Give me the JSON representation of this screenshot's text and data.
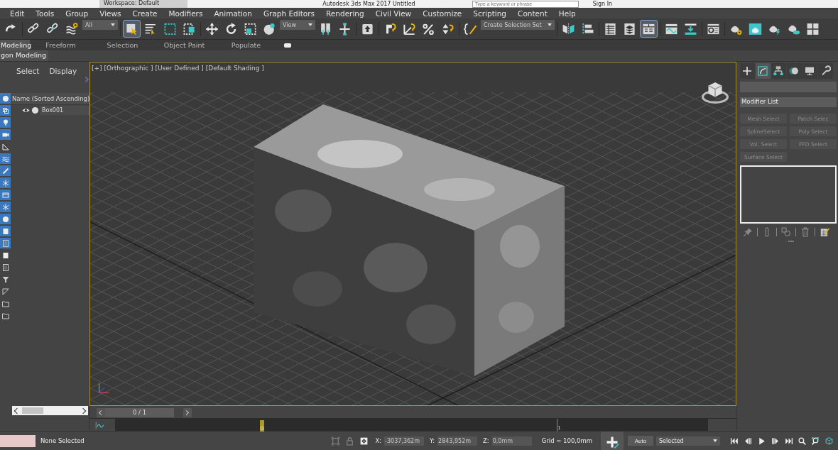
{
  "title_bar": {
    "workspace": "Workspace: Default",
    "title": "Autodesk 3ds Max 2017   Untitled",
    "search": {
      "placeholder": "Type a keyword or phrase"
    },
    "sign_in": "Sign In"
  },
  "menu": [
    "Edit",
    "Tools",
    "Group",
    "Views",
    "Create",
    "Modifiers",
    "Animation",
    "Graph Editors",
    "Rendering",
    "Civil View",
    "Customize",
    "Scripting",
    "Content",
    "Help"
  ],
  "toolbar": [
    {
      "kind": "tool",
      "selected": false
    },
    {
      "kind": "tool",
      "selected": false
    },
    {
      "kind": "tool",
      "selected": false
    },
    {
      "kind": "tool",
      "selected": false
    },
    {
      "kind": "dropdown",
      "value": "All"
    },
    {
      "kind": "tool",
      "selected": true
    },
    {
      "kind": "tool",
      "selected": false
    },
    {
      "kind": "tool",
      "selected": false
    },
    {
      "kind": "tool",
      "selected": false
    },
    {
      "kind": "tool",
      "selected": false
    },
    {
      "kind": "tool",
      "selected": false
    },
    {
      "kind": "tool",
      "selected": false
    },
    {
      "kind": "tool",
      "selected": false
    },
    {
      "kind": "dropdown",
      "value": "View"
    },
    {
      "kind": "tool",
      "selected": false
    },
    {
      "kind": "tool",
      "selected": false
    },
    {
      "kind": "tool",
      "selected": false
    },
    {
      "kind": "tool",
      "selected": false
    },
    {
      "kind": "tool",
      "selected": false
    },
    {
      "kind": "tool",
      "selected": false
    },
    {
      "kind": "tool",
      "selected": false
    },
    {
      "kind": "tool",
      "selected": false
    },
    {
      "kind": "dropdown",
      "value": "Create Selection Set"
    },
    {
      "kind": "tool",
      "selected": false
    },
    {
      "kind": "tool",
      "selected": false
    },
    {
      "kind": "tool",
      "selected": false
    },
    {
      "kind": "tool",
      "selected": false
    },
    {
      "kind": "tool",
      "selected": true
    },
    {
      "kind": "tool",
      "selected": false
    },
    {
      "kind": "tool",
      "selected": false
    },
    {
      "kind": "tool",
      "selected": false
    },
    {
      "kind": "tool",
      "selected": false
    },
    {
      "kind": "tool",
      "selected": false
    },
    {
      "kind": "tool",
      "selected": false
    },
    {
      "kind": "tool",
      "selected": false
    },
    {
      "kind": "tool",
      "selected": false
    }
  ],
  "ribbon": {
    "tabs": [
      {
        "label": "Modeling",
        "selected": true
      },
      {
        "label": "Freeform",
        "selected": false
      },
      {
        "label": "Selection",
        "selected": false
      },
      {
        "label": "Object Paint",
        "selected": false
      },
      {
        "label": "Populate",
        "selected": false
      }
    ],
    "panel_tab": "gon Modeling"
  },
  "scene_explorer": {
    "menu": [
      "Select",
      "Display"
    ],
    "filters": [
      {
        "selected": true
      },
      {
        "selected": true
      },
      {
        "selected": true
      },
      {
        "selected": true
      },
      {
        "selected": false
      },
      {
        "selected": true
      },
      {
        "selected": true
      },
      {
        "selected": true
      },
      {
        "selected": true
      },
      {
        "selected": true
      },
      {
        "selected": true
      },
      {
        "selected": true
      },
      {
        "selected": true
      },
      {
        "selected": false
      },
      {
        "selected": false
      },
      {
        "selected": false
      },
      {
        "selected": false
      },
      {
        "selected": false
      },
      {
        "selected": false
      }
    ],
    "column": "Name (Sorted Ascending)",
    "rows": [
      {
        "name": "Box001"
      }
    ]
  },
  "viewport": {
    "label": "[+] [Orthographic ] [User Defined ] [Default Shading ]",
    "active": true
  },
  "command_panel": {
    "tabs": [
      {
        "selected": false
      },
      {
        "selected": true
      },
      {
        "selected": false
      },
      {
        "selected": false
      },
      {
        "selected": false
      },
      {
        "selected": false
      }
    ],
    "modifier_list": "Modifier List",
    "buttons": [
      {
        "label": "Mesh Select",
        "disabled": true
      },
      {
        "label": "Patch Selec",
        "disabled": true
      },
      {
        "label": "SplineSelect",
        "disabled": true
      },
      {
        "label": "Poly Select",
        "disabled": true
      },
      {
        "label": "Vol. Select",
        "disabled": true
      },
      {
        "label": "FFD Select",
        "disabled": true
      },
      {
        "label": "Surface Select",
        "disabled": true
      }
    ]
  },
  "time_slider": {
    "label": "0 / 1",
    "level": 0
  },
  "track_bar": {
    "current": "0",
    "tick": "1"
  },
  "status_bar": {
    "prompt": "None Selected",
    "x_label": "X:",
    "x": "-3037,362m",
    "y_label": "Y:",
    "y": "2843,952m",
    "z_label": "Z:",
    "z": "0,0mm",
    "grid": "Grid = 100,0mm",
    "auto_key": "Auto",
    "key_filter": "Selected"
  }
}
